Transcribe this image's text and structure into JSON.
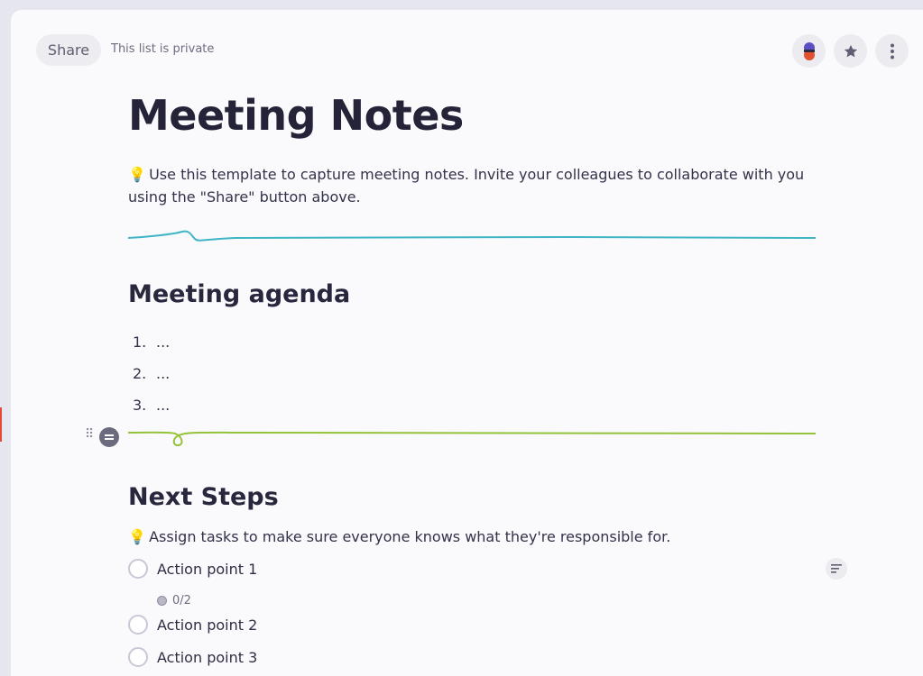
{
  "header": {
    "share_label": "Share",
    "privacy_text": "This list is private",
    "actions": [
      {
        "name": "collaborators",
        "icon": "collaborators-icon"
      },
      {
        "name": "favorite",
        "icon": "star-icon"
      },
      {
        "name": "more",
        "icon": "more-vertical-icon"
      }
    ]
  },
  "document": {
    "title": "Meeting Notes",
    "intro_icon": "💡",
    "intro_text": "Use this template to capture meeting notes. Invite your colleagues to collaborate with you using the \"Share\" button above.",
    "agenda": {
      "heading": "Meeting agenda",
      "items": [
        {
          "num": "1.",
          "text": "..."
        },
        {
          "num": "2.",
          "text": "..."
        },
        {
          "num": "3.",
          "text": "..."
        }
      ]
    },
    "next_steps": {
      "heading": "Next Steps",
      "desc_icon": "💡",
      "desc_text": "Assign tasks to make sure everyone knows what they're responsible for.",
      "tasks": [
        {
          "label": "Action point 1",
          "subtasks": "0/2"
        },
        {
          "label": "Action point 2"
        },
        {
          "label": "Action point 3"
        }
      ]
    }
  },
  "colors": {
    "divider_teal": "#3fb5c6",
    "divider_green": "#94c23a",
    "collab_blue": "#5a4fc4",
    "collab_red": "#e0512f"
  }
}
